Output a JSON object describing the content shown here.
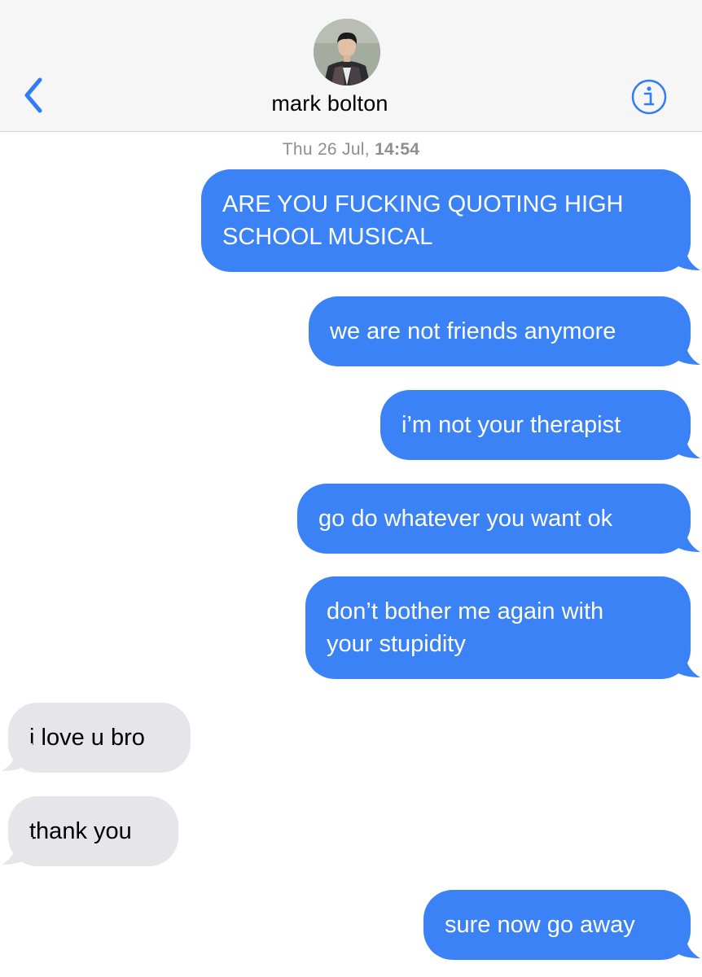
{
  "header": {
    "contact_name": "mark bolton",
    "back_icon": "chevron-left-icon",
    "info_icon": "info-circle-icon"
  },
  "thread": {
    "timestamp_day": "Thu 26 Jul,",
    "timestamp_time": "14:54"
  },
  "messages": [
    {
      "direction": "sent",
      "lines": [
        "ARE YOU FUCKING QUOTING HIGH",
        "SCHOOL MUSICAL"
      ]
    },
    {
      "direction": "sent",
      "lines": [
        "we are not friends anymore"
      ]
    },
    {
      "direction": "sent",
      "lines": [
        "i’m not your therapist"
      ]
    },
    {
      "direction": "sent",
      "lines": [
        "go do whatever you want ok"
      ]
    },
    {
      "direction": "sent",
      "lines": [
        "don’t bother me again with",
        "your stupidity"
      ]
    },
    {
      "direction": "received",
      "lines": [
        "i love u bro"
      ]
    },
    {
      "direction": "received",
      "lines": [
        "thank you"
      ]
    },
    {
      "direction": "sent",
      "lines": [
        "sure now go away"
      ]
    }
  ],
  "colors": {
    "sent_bubble": "#3a82f6",
    "received_bubble": "#e5e5ea",
    "accent": "#2f7cf6",
    "header_bg": "#f6f6f7",
    "timestamp": "#8e8e93"
  }
}
